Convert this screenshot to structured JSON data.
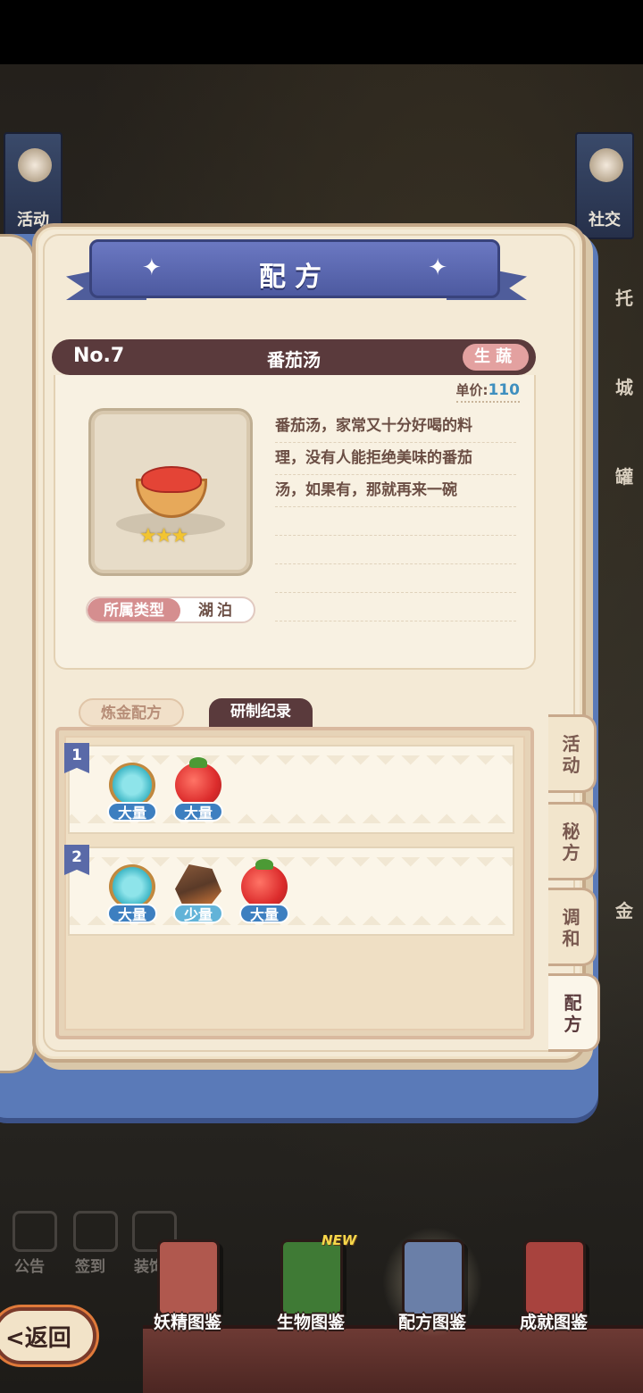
{
  "scene": {
    "left_banner_label": "活动",
    "right_banner_label": "社交",
    "right_strip_labels": [
      "托",
      "城",
      "罐",
      "金"
    ],
    "hud_labels": [
      "公告",
      "签到",
      "装饰"
    ]
  },
  "page_title": "配方",
  "item": {
    "number": "No.7",
    "name": "番茄汤",
    "tag": "生蔬",
    "price_label": "单价:",
    "price_value": "110",
    "star_count": 3,
    "type_key": "所属类型",
    "type_value": "湖泊",
    "description_lines": [
      "番茄汤，家常又十分好喝的料",
      "理，没有人能拒绝美味的番茄",
      "汤，如果有，那就再来一碗"
    ]
  },
  "tabs": {
    "alchemy": "炼金配方",
    "records": "研制纪录"
  },
  "records": [
    {
      "index": "1",
      "ingredients": [
        {
          "icon": "water-icon",
          "qty": "大量"
        },
        {
          "icon": "tomato-icon",
          "qty": "大量"
        }
      ]
    },
    {
      "index": "2",
      "ingredients": [
        {
          "icon": "water-icon",
          "qty": "大量"
        },
        {
          "icon": "rock-icon",
          "qty": "少量"
        },
        {
          "icon": "tomato-icon",
          "qty": "大量"
        }
      ]
    }
  ],
  "side_tabs": [
    {
      "label": "活动",
      "active": false
    },
    {
      "label": "秘方",
      "active": false
    },
    {
      "label": "调和",
      "active": false
    },
    {
      "label": "配方",
      "active": true
    }
  ],
  "bottom_nav": [
    {
      "label": "妖精图鉴",
      "icon": "fairy-book-icon",
      "color": "#b0584e",
      "new": false
    },
    {
      "label": "生物图鉴",
      "icon": "creature-book-icon",
      "color": "#3f7a35",
      "new": true
    },
    {
      "label": "配方图鉴",
      "icon": "recipe-book-icon",
      "color": "#6a7fa8",
      "new": false,
      "active": true
    },
    {
      "label": "成就图鉴",
      "icon": "achievement-book-icon",
      "color": "#a8433e",
      "new": false
    }
  ],
  "new_badge": "NEW",
  "back_label": "<返回"
}
